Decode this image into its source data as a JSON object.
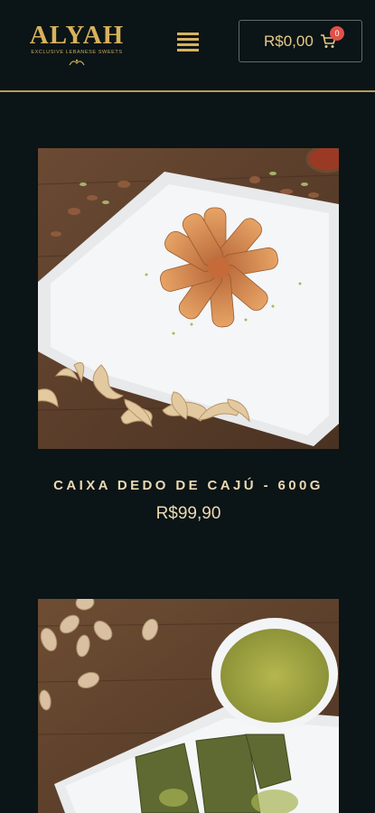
{
  "header": {
    "logo": {
      "name": "ALYAH",
      "tagline": "EXCLUSIVE LEBANESE SWEETS"
    },
    "cart": {
      "total": "R$0,00",
      "count": "0"
    }
  },
  "products": [
    {
      "name": "CAIXA DEDO DE CAJÚ - 600G",
      "price": "R$99,90"
    }
  ],
  "colors": {
    "background": "#0b1416",
    "accent": "#d7b25d",
    "badge": "#e0504a",
    "text": "#ead9b2"
  },
  "icons": [
    "hamburger-menu-icon",
    "shopping-cart-icon"
  ]
}
